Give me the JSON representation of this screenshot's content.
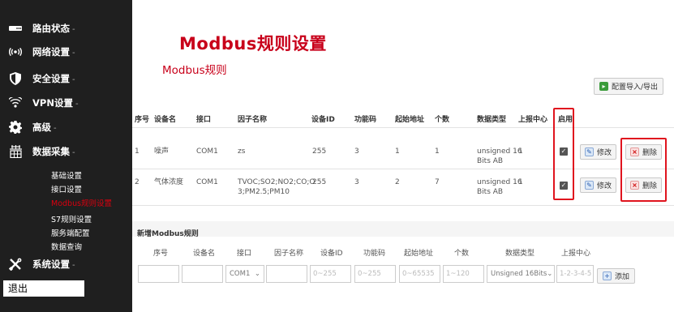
{
  "sidebar": {
    "items": [
      {
        "label": "路由状态",
        "icon": "router-icon"
      },
      {
        "label": "网络设置",
        "icon": "wifi-signal-icon"
      },
      {
        "label": "安全设置",
        "icon": "shield-icon"
      },
      {
        "label": "VPN设置",
        "icon": "vpn-signal-icon"
      },
      {
        "label": "高级",
        "icon": "gear-icon"
      },
      {
        "label": "数据采集",
        "icon": "data-collect-icon"
      },
      {
        "label": "系统设置",
        "icon": "tools-icon"
      }
    ],
    "chevron": "-",
    "sub_items": [
      "基础设置",
      "接口设置",
      "Modbus规则设置",
      "S7规则设置",
      "服务端配置",
      "数据查询"
    ],
    "logout": "退出"
  },
  "main": {
    "title": "Modbus规则设置",
    "section": "Modbus规则",
    "import_export": "配置导入/导出",
    "columns": [
      "序号",
      "设备名",
      "接口",
      "因子名称",
      "设备ID",
      "功能码",
      "起始地址",
      "个数",
      "数据类型",
      "上报中心",
      "启用"
    ],
    "rows": [
      {
        "index": "1",
        "device": "噪声",
        "port": "COM1",
        "factor": [
          "zs"
        ],
        "device_id": "255",
        "func": "3",
        "start": "1",
        "count": "1",
        "dtype": [
          "unsigned 16",
          "Bits AB"
        ],
        "report": "1",
        "enabled": true
      },
      {
        "index": "2",
        "device": "气体浓度",
        "port": "COM1",
        "factor": [
          "TVOC;SO2;NO2;CO;O",
          "3;PM2.5;PM10"
        ],
        "device_id": "255",
        "func": "3",
        "start": "2",
        "count": "7",
        "dtype": [
          "unsigned 16",
          "Bits AB"
        ],
        "report": "1",
        "enabled": true
      }
    ],
    "edit_label": "修改",
    "delete_label": "删除",
    "new_rule": {
      "title": "新增Modbus规则",
      "columns": [
        "序号",
        "设备名",
        "接口",
        "因子名称",
        "设备ID",
        "功能码",
        "起始地址",
        "个数",
        "数据类型",
        "上报中心"
      ],
      "port_value": "COM1",
      "placeholders": {
        "device_id": "0~255",
        "func": "0~255",
        "start": "0~65535",
        "count": "1~120",
        "report": "1-2-3-4-5"
      },
      "dtype_value": "Unsigned 16Bits",
      "add_label": "添加"
    }
  },
  "colors": {
    "sidebar_bg": "#1f1f1f",
    "accent_red": "#c8001a",
    "highlight_box": "#e0141e",
    "active_sub": "#d9000f"
  }
}
